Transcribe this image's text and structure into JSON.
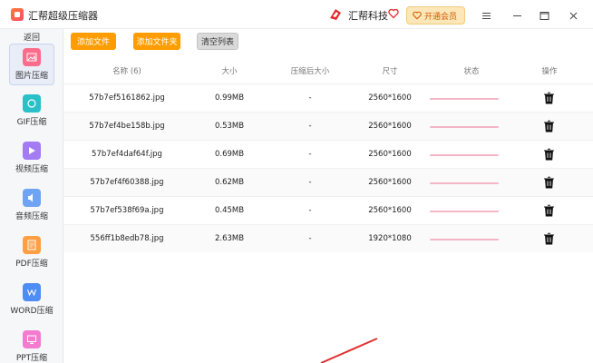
{
  "app": {
    "title": "汇帮超级压缩器",
    "brand": "汇帮科技",
    "vip_label": "开通会员"
  },
  "sidebar": {
    "back": "返回",
    "items": [
      {
        "label": "图片压缩",
        "icon": "image-icon",
        "color": "#ff6b8a",
        "active": true
      },
      {
        "label": "GIF压缩",
        "icon": "gif-icon",
        "color": "#2bc0c8"
      },
      {
        "label": "视频压缩",
        "icon": "video-icon",
        "color": "#a37bf2"
      },
      {
        "label": "音频压缩",
        "icon": "audio-icon",
        "color": "#6fa4f5"
      },
      {
        "label": "PDF压缩",
        "icon": "pdf-icon",
        "color": "#ff9f43"
      },
      {
        "label": "WORD压缩",
        "icon": "word-icon",
        "color": "#4e8df5"
      },
      {
        "label": "PPT压缩",
        "icon": "ppt-icon",
        "color": "#f37bd0"
      }
    ]
  },
  "toolbar": {
    "add_file": "添加文件",
    "add_folder": "添加文件夹",
    "clear_list": "清空列表"
  },
  "table": {
    "headers": [
      "名称 (6)",
      "大小",
      "压缩后大小",
      "尺寸",
      "状态",
      "操作"
    ],
    "rows": [
      {
        "name": "57b7ef5161862.jpg",
        "size": "0.99MB",
        "compressed": "-",
        "dimensions": "2560*1600"
      },
      {
        "name": "57b7ef4be158b.jpg",
        "size": "0.53MB",
        "compressed": "-",
        "dimensions": "2560*1600"
      },
      {
        "name": "57b7ef4daf64f.jpg",
        "size": "0.69MB",
        "compressed": "-",
        "dimensions": "2560*1600"
      },
      {
        "name": "57b7ef4f60388.jpg",
        "size": "0.62MB",
        "compressed": "-",
        "dimensions": "2560*1600"
      },
      {
        "name": "57b7ef538f69a.jpg",
        "size": "0.45MB",
        "compressed": "-",
        "dimensions": "2560*1600"
      },
      {
        "name": "556ff1b8edb78.jpg",
        "size": "2.63MB",
        "compressed": "-",
        "dimensions": "1920*1080"
      }
    ]
  },
  "colors": {
    "accent_orange": "#ff9d00",
    "status_pink": "#f4b6c6",
    "pointer_red": "#e03030"
  }
}
